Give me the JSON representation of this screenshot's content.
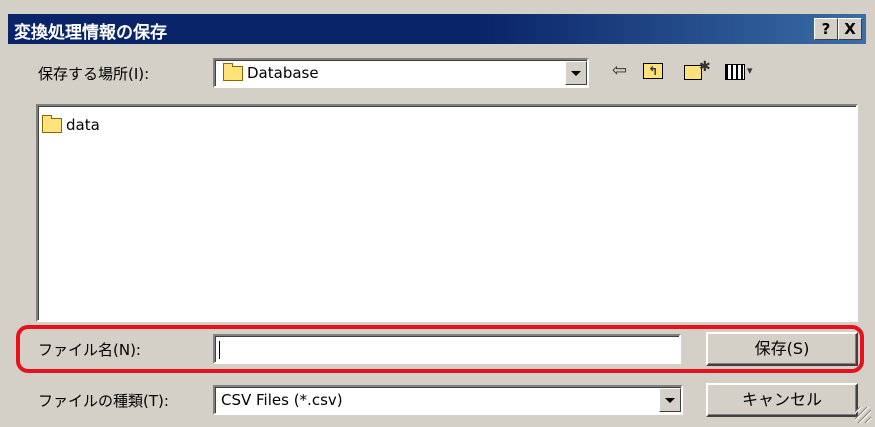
{
  "window": {
    "title": "変換処理情報の保存",
    "help_label": "?",
    "close_label": "X"
  },
  "save_in": {
    "label": "保存する場所(I):",
    "value": "Database"
  },
  "toolbar": {
    "back_icon": "back-arrow-icon",
    "up_icon": "up-folder-icon",
    "new_folder_icon": "new-folder-icon",
    "view_icon": "view-menu-icon"
  },
  "file_list": {
    "items": [
      {
        "name": "data",
        "icon": "folder-icon"
      }
    ]
  },
  "filename": {
    "label": "ファイル名(N):",
    "value": ""
  },
  "filetype": {
    "label": "ファイルの種類(T):",
    "value": "CSV Files (*.csv)"
  },
  "buttons": {
    "save": "保存(S)",
    "cancel": "キャンセル"
  },
  "colors": {
    "titlebar": "#0a246a",
    "highlight": "#e8101a",
    "dialog_bg": "#d4d0c8"
  }
}
